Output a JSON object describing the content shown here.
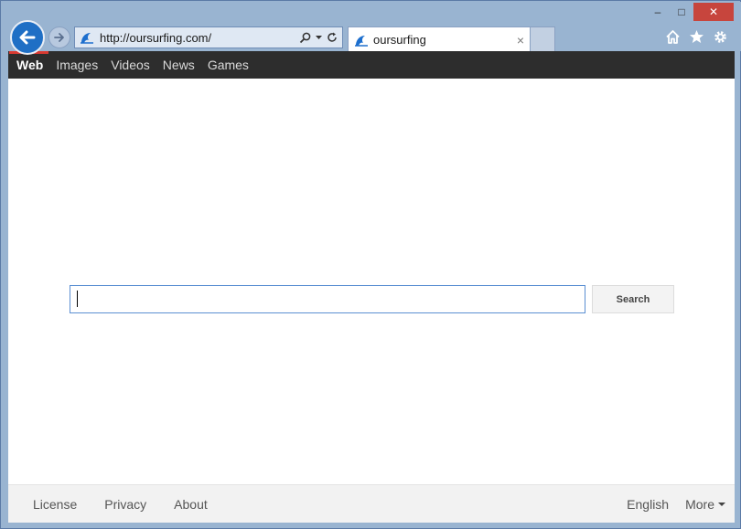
{
  "browser": {
    "address": {
      "url": "http://oursurfing.com/"
    },
    "tab": {
      "title": "oursurfing",
      "close": "×"
    },
    "window_controls": {
      "minimize": "–",
      "maximize": "□",
      "close": "✕"
    },
    "icons": [
      "back-arrow-icon",
      "forward-arrow-icon",
      "site-favicon",
      "search-icon",
      "dropdown-icon",
      "refresh-icon",
      "home-icon",
      "star-icon",
      "gear-icon"
    ]
  },
  "page": {
    "nav": {
      "items": [
        {
          "label": "Web",
          "active": true
        },
        {
          "label": "Images",
          "active": false
        },
        {
          "label": "Videos",
          "active": false
        },
        {
          "label": "News",
          "active": false
        },
        {
          "label": "Games",
          "active": false
        }
      ]
    },
    "search": {
      "value": "",
      "button_label": "Search"
    },
    "footer": {
      "links": [
        "License",
        "Privacy",
        "About"
      ],
      "language": "English",
      "more": "More"
    }
  },
  "colors": {
    "frame": "#99b4d1",
    "navbar": "#2d2d2d",
    "active_accent": "#d93a32",
    "back_button": "#1f6fc5",
    "close_button": "#c7453d"
  }
}
